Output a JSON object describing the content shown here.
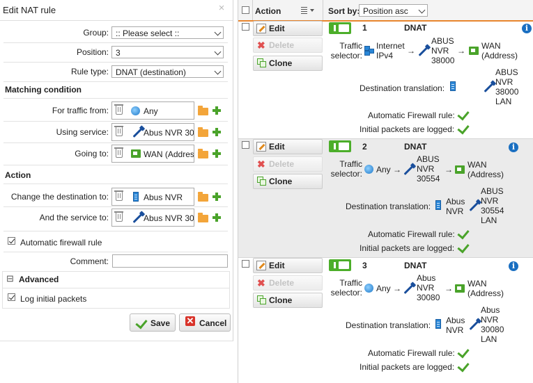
{
  "dialog": {
    "title": "Edit NAT rule",
    "close_symbol": "×",
    "group_label": "Group:",
    "group_value": ":: Please select ::",
    "position_label": "Position:",
    "position_value": "3",
    "ruletype_label": "Rule type:",
    "ruletype_value": "DNAT (destination)",
    "matching_title": "Matching condition",
    "from_label": "For traffic from:",
    "from_value": "Any",
    "service_label": "Using service:",
    "service_value": "Abus NVR 30",
    "going_label": "Going to:",
    "going_value": "WAN (Addres",
    "action_title": "Action",
    "change_dest_label": "Change the destination to:",
    "change_dest_value": "Abus NVR",
    "and_service_label": "And the service to:",
    "and_service_value": "Abus NVR 30",
    "auto_fw_label": "Automatic firewall rule",
    "comment_label": "Comment:",
    "comment_value": "",
    "advanced_title": "Advanced",
    "collapse_symbol": "⊟",
    "log_label": "Log initial packets",
    "save_label": "Save",
    "cancel_label": "Cancel"
  },
  "list": {
    "header": {
      "action_label": "Action",
      "sort_label": "Sort by:",
      "sort_value": "Position asc"
    },
    "button_labels": {
      "edit": "Edit",
      "delete": "Delete",
      "clone": "Clone"
    },
    "common": {
      "traffic": "Traffic",
      "selector": "selector:",
      "dest_translation": "Destination translation:",
      "auto_fw": "Automatic Firewall rule:",
      "logged": "Initial packets are logged:",
      "arrow": "→",
      "info": "i"
    },
    "rules": [
      {
        "number": "1",
        "type": "DNAT",
        "source_lines": [
          "Internet",
          "IPv4"
        ],
        "service_lines": [
          "ABUS",
          "NVR",
          "38000"
        ],
        "destination_lines": [
          "WAN",
          "(Address)"
        ],
        "translation_host_lines": [],
        "translation_service_lines": [
          "ABUS",
          "NVR",
          "38000",
          "LAN"
        ]
      },
      {
        "number": "2",
        "type": "DNAT",
        "source_lines": [
          "Any"
        ],
        "service_lines": [
          "ABUS",
          "NVR",
          "30554"
        ],
        "destination_lines": [
          "WAN",
          "(Address)"
        ],
        "translation_host_lines": [
          "Abus",
          "NVR"
        ],
        "translation_service_lines": [
          "ABUS",
          "NVR",
          "30554",
          "LAN"
        ]
      },
      {
        "number": "3",
        "type": "DNAT",
        "source_lines": [
          "Any"
        ],
        "service_lines": [
          "Abus",
          "NVR",
          "30080"
        ],
        "destination_lines": [
          "WAN",
          "(Address)"
        ],
        "translation_host_lines": [
          "Abus",
          "NVR"
        ],
        "translation_service_lines": [
          "Abus",
          "NVR",
          "30080",
          "LAN"
        ]
      }
    ]
  },
  "colors": {
    "accent_green": "#4aa32a",
    "info_blue": "#1a6fc1",
    "highlight_row": "#ebebeb"
  },
  "icons": [
    "close-icon",
    "trash-icon",
    "globe-icon",
    "cable-icon",
    "network-card-icon",
    "server-icon",
    "multi-host-icon",
    "folder-icon",
    "plus-icon",
    "checkmark-icon",
    "edit-icon",
    "delete-icon",
    "clone-icon",
    "info-icon",
    "column-menu-icon",
    "chevron-down-icon"
  ]
}
